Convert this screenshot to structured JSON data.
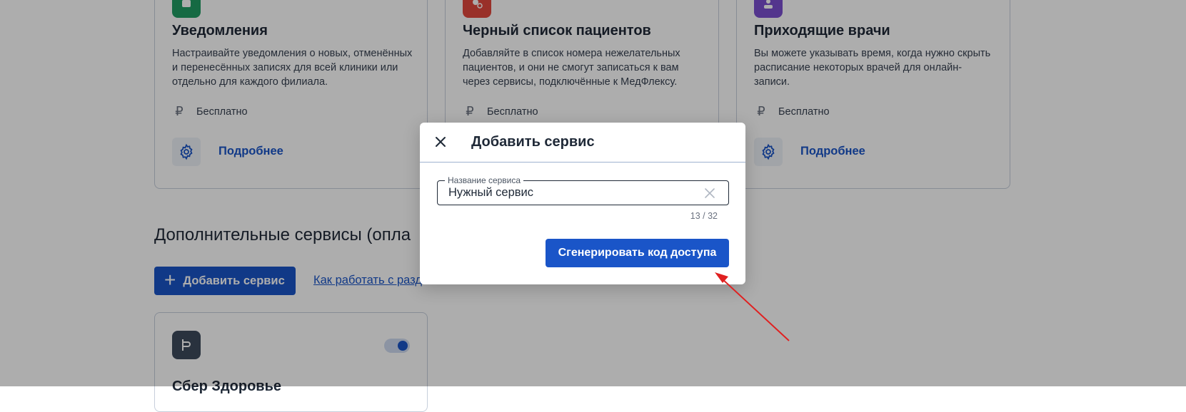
{
  "cards": [
    {
      "title": "Уведомления",
      "description": "Настраивайте уведомления о новых, отменённых и перенесённых записях для всей клиники или отдельно для каждого филиала.",
      "price": "Бесплатно",
      "more_label": "Подробнее",
      "icon": "bell-icon",
      "icon_color": "#1f9d63"
    },
    {
      "title": "Черный список пациентов",
      "description": "Добавляйте в список номера нежелательных пациентов, и они не смогут записаться к вам через сервисы, подключённые к МедФлексу.",
      "price": "Бесплатно",
      "more_label": "Подробнее",
      "icon": "blocked-user-icon",
      "icon_color": "#e2483d"
    },
    {
      "title": "Приходящие врачи",
      "description": "Вы можете указывать время, когда нужно скрыть расписание некоторых врачей для онлайн-записи.",
      "price": "Бесплатно",
      "more_label": "Подробнее",
      "icon": "doctor-icon",
      "icon_color": "#7b4fd0"
    }
  ],
  "currency_symbol": "₽",
  "section": {
    "title": "Дополнительные сервисы (опла",
    "add_button": "Добавить сервис",
    "help_link": "Как работать с разд"
  },
  "service_card": {
    "title": "Сбер Здоровье",
    "toggle_on": true,
    "icon": "service-logo-icon"
  },
  "modal": {
    "title": "Добавить сервис",
    "field_label": "Название сервиса",
    "field_value": "Нужный сервис",
    "counter": "13 / 32",
    "submit_label": "Сгенерировать код доступа"
  },
  "colors": {
    "accent": "#1a55c8",
    "overlay": "rgba(0,0,0,0.32)",
    "annotation_arrow": "#e02020"
  }
}
